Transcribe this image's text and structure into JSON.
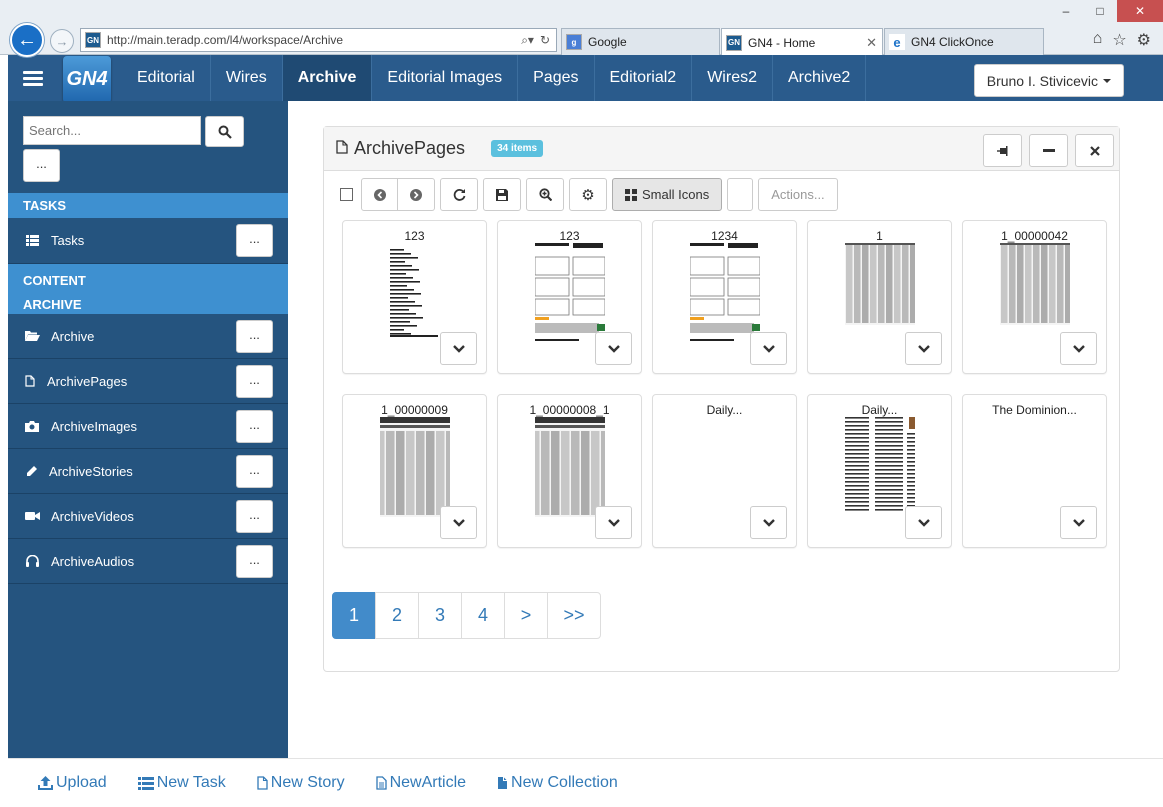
{
  "browser": {
    "url": "http://main.teradp.com/l4/workspace/Archive",
    "favicon": "GN",
    "tabs": [
      {
        "label": "Google",
        "icon": "google-icon"
      },
      {
        "label": "GN4 - Home",
        "icon": "gn4-favicon"
      },
      {
        "label": "GN4 ClickOnce",
        "icon": "ie-icon"
      }
    ]
  },
  "app": {
    "logo": "GN4",
    "nav": [
      "Editorial",
      "Wires",
      "Archive",
      "Editorial Images",
      "Pages",
      "Editorial2",
      "Wires2",
      "Archive2"
    ],
    "active_nav": "Archive",
    "user": "Bruno I. Stivicevic"
  },
  "sidebar": {
    "search_placeholder": "Search...",
    "more": "...",
    "tasks_header": "TASKS",
    "tasks_item": "Tasks",
    "content_header_1": "CONTENT",
    "content_header_2": "ARCHIVE",
    "items": [
      {
        "label": "Archive",
        "icon": "folder-open-icon"
      },
      {
        "label": "ArchivePages",
        "icon": "file-icon"
      },
      {
        "label": "ArchiveImages",
        "icon": "camera-icon"
      },
      {
        "label": "ArchiveStories",
        "icon": "pencil-icon"
      },
      {
        "label": "ArchiveVideos",
        "icon": "video-camera-icon"
      },
      {
        "label": "ArchiveAudios",
        "icon": "headphones-icon"
      }
    ]
  },
  "panel": {
    "title": "ArchivePages",
    "badge": "34 items",
    "toolbar": {
      "small_icons": "Small Icons",
      "actions": "Actions..."
    },
    "cards": [
      {
        "label": "123",
        "thumb": "text-doc"
      },
      {
        "label": "123",
        "thumb": "ad-page"
      },
      {
        "label": "1234",
        "thumb": "ad-page"
      },
      {
        "label": "1",
        "thumb": "newspaper"
      },
      {
        "label": "1_00000042",
        "thumb": "newspaper"
      },
      {
        "label": "1_00000009",
        "thumb": "newspaper-head"
      },
      {
        "label": "1_00000008_1",
        "thumb": "newspaper-head"
      },
      {
        "label": "Daily...",
        "thumb": "none"
      },
      {
        "label": "Daily...",
        "thumb": "columns"
      },
      {
        "label": "The Dominion...",
        "thumb": "none"
      }
    ],
    "pager": [
      "1",
      "2",
      "3",
      "4",
      ">",
      ">>"
    ],
    "active_page": "1"
  },
  "footer": {
    "links": [
      {
        "label": "Upload",
        "icon": "upload-icon"
      },
      {
        "label": "New Task",
        "icon": "list-icon"
      },
      {
        "label": "New Story",
        "icon": "file-icon"
      },
      {
        "label": "NewArticle",
        "icon": "file-text-icon"
      },
      {
        "label": "New Collection",
        "icon": "file-solid-icon"
      }
    ]
  },
  "colors": {
    "header_bg": "#2a5b8c",
    "sidebar_bg": "#25547f",
    "section_bg": "#3e90d0",
    "link": "#337ab7",
    "badge": "#5bc0de",
    "active_page": "#428bca"
  }
}
